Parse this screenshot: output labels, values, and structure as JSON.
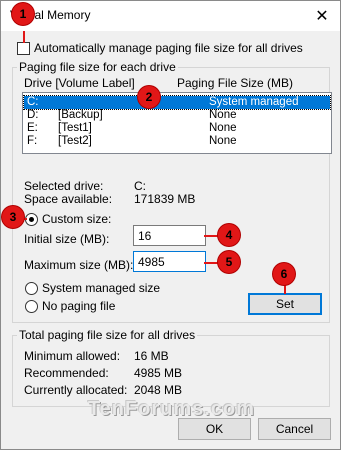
{
  "window": {
    "title": "Virtual Memory",
    "close_label": "✕"
  },
  "auto_manage": {
    "label": "Automatically manage paging file size for all drives",
    "checked": false
  },
  "paging_group": {
    "title": "Paging file size for each drive",
    "header_drive": "Drive  [Volume Label]",
    "header_size": "Paging File Size (MB)",
    "drives": [
      {
        "drive": "C:",
        "label": "",
        "size": "System managed",
        "selected": true
      },
      {
        "drive": "D:",
        "label": "[Backup]",
        "size": "None",
        "selected": false
      },
      {
        "drive": "E:",
        "label": "[Test1]",
        "size": "None",
        "selected": false
      },
      {
        "drive": "F:",
        "label": "[Test2]",
        "size": "None",
        "selected": false
      }
    ],
    "selected_drive_label": "Selected drive:",
    "selected_drive_value": "C:",
    "space_available_label": "Space available:",
    "space_available_value": "171839 MB",
    "custom_size_label": "Custom size:",
    "initial_size_label": "Initial size (MB):",
    "initial_size_value": "16",
    "maximum_size_label": "Maximum size (MB):",
    "maximum_size_value": "4985",
    "system_managed_label": "System managed size",
    "no_paging_label": "No paging file",
    "set_button": "Set",
    "selected_option": "custom"
  },
  "total_group": {
    "title": "Total paging file size for all drives",
    "min_label": "Minimum allowed:",
    "min_value": "16 MB",
    "recommended_label": "Recommended:",
    "recommended_value": "4985 MB",
    "allocated_label": "Currently allocated:",
    "allocated_value": "2048 MB"
  },
  "buttons": {
    "ok": "OK",
    "cancel": "Cancel"
  },
  "callouts": [
    "1",
    "2",
    "3",
    "4",
    "5",
    "6"
  ],
  "watermark": "TenForums.com",
  "colors": {
    "callout": "#e11717",
    "selection": "#0078d7"
  }
}
